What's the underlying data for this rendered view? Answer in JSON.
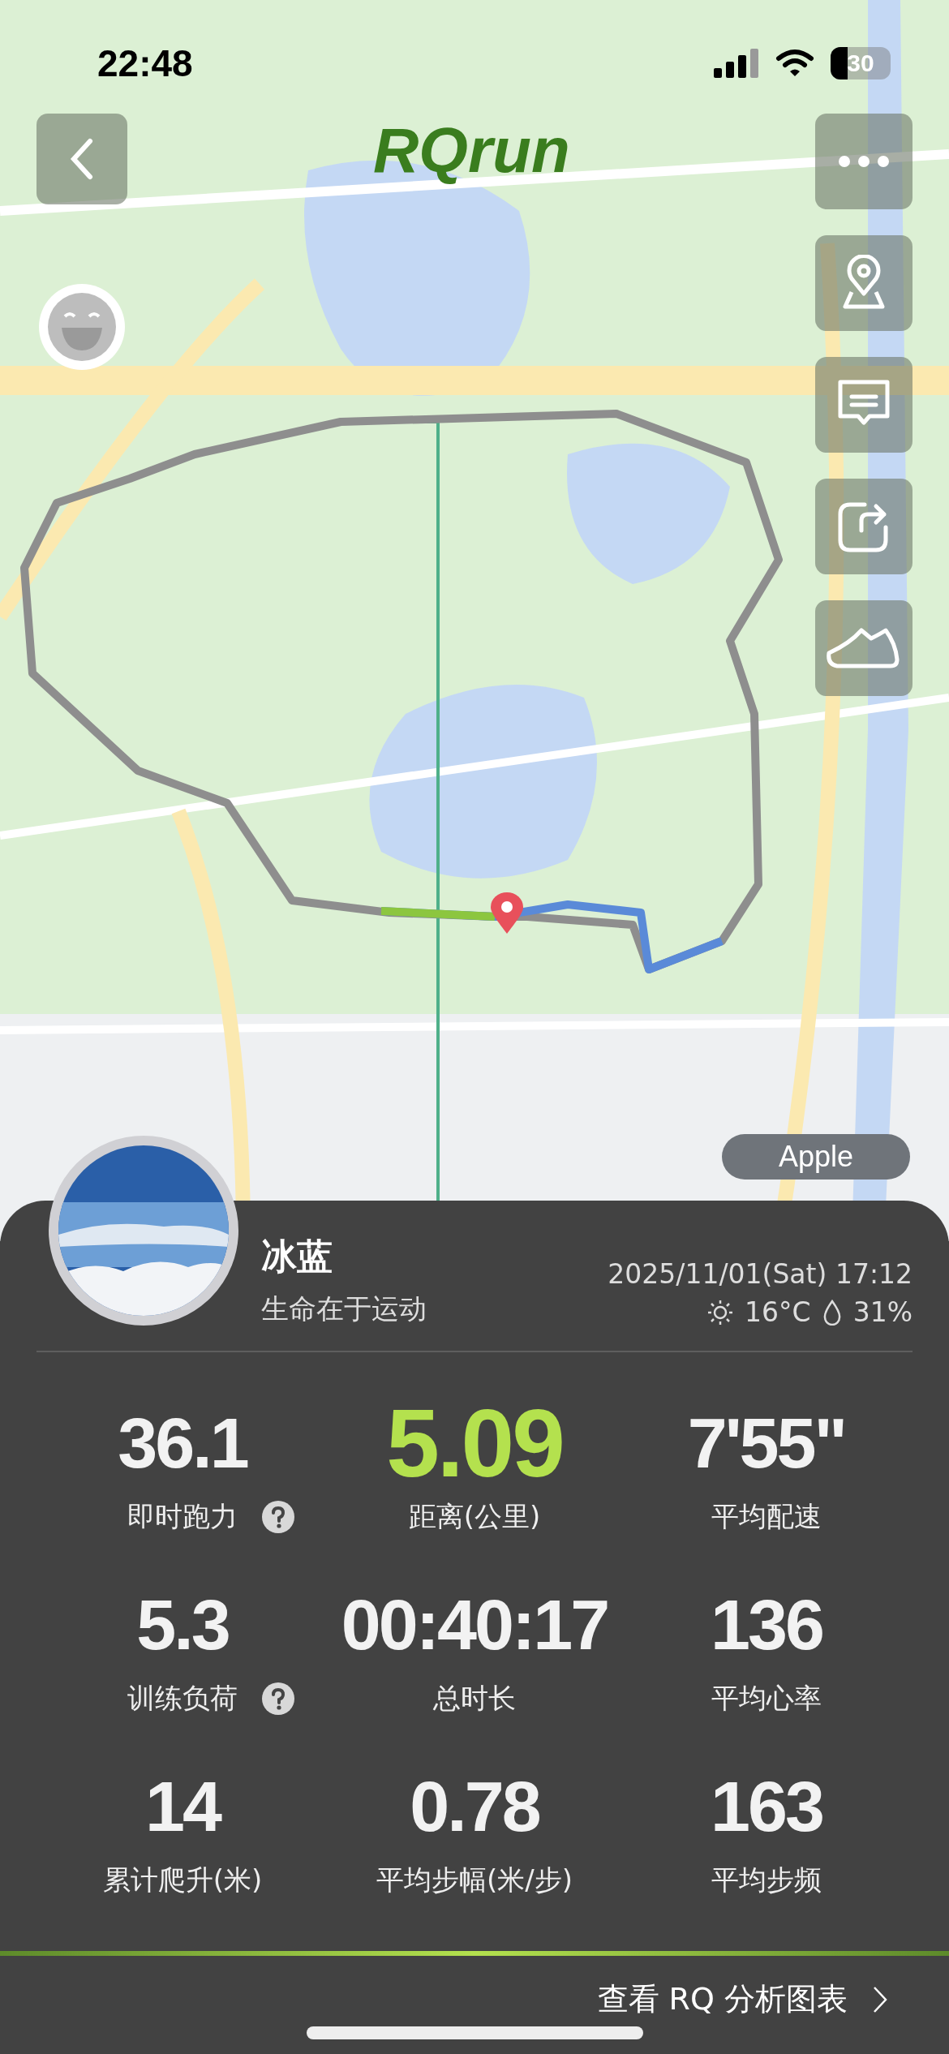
{
  "status_bar": {
    "time": "22:48",
    "battery": "30"
  },
  "logo": "RQrun",
  "map": {
    "attribution": "Apple"
  },
  "profile": {
    "name": "冰蓝",
    "motto": "生命在于运动",
    "datetime": "2025/11/01(Sat) 17:12",
    "temperature": "16°C",
    "humidity": "31%"
  },
  "stats": [
    {
      "value": "36.1",
      "label": "即时跑力",
      "help": true,
      "highlight": false
    },
    {
      "value": "5.09",
      "label": "距离(公里)",
      "help": false,
      "highlight": true
    },
    {
      "value": "7'55\"",
      "label": "平均配速",
      "help": false,
      "highlight": false
    },
    {
      "value": "5.3",
      "label": "训练负荷",
      "help": true,
      "highlight": false
    },
    {
      "value": "00:40:17",
      "label": "总时长",
      "help": false,
      "highlight": false
    },
    {
      "value": "136",
      "label": "平均心率",
      "help": false,
      "highlight": false
    },
    {
      "value": "14",
      "label": "累计爬升(米)",
      "help": false,
      "highlight": false
    },
    {
      "value": "0.78",
      "label": "平均步幅(米/步)",
      "help": false,
      "highlight": false
    },
    {
      "value": "163",
      "label": "平均步频",
      "help": false,
      "highlight": false
    }
  ],
  "footer_link": "查看 RQ 分析图表"
}
